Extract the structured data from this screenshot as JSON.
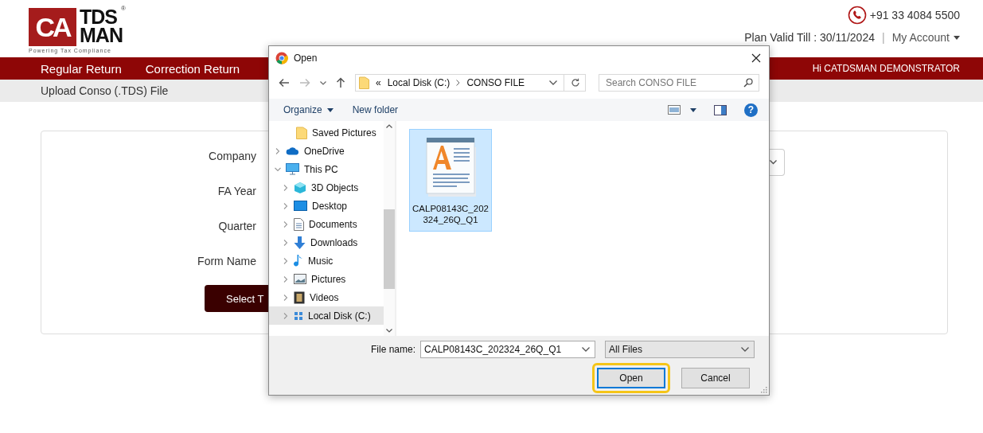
{
  "header": {
    "logo": {
      "mark": "CA",
      "line_1": "TDS",
      "line_2": "MAN",
      "tagline": "Powering Tax Compliance",
      "registered": "®"
    },
    "phone": "+91 33 4084 5500",
    "plan_valid": "Plan Valid Till : 30/11/2024",
    "separator": "|",
    "account_menu": "My Account"
  },
  "nav": {
    "items": [
      {
        "label": "Regular Return"
      },
      {
        "label": "Correction Return"
      }
    ],
    "greeting": "Hi CATDSMAN DEMONSTRATOR"
  },
  "breadcrumb": "Upload Conso (.TDS) File",
  "form": {
    "fields": [
      {
        "label": "Company"
      },
      {
        "label": "FA Year"
      },
      {
        "label": "Quarter"
      },
      {
        "label": "Form Name"
      }
    ],
    "button": "Select T"
  },
  "dialog": {
    "title": "Open",
    "path": {
      "overflow": "«",
      "segments": [
        "Local Disk (C:)",
        "CONSO FILE"
      ]
    },
    "search": {
      "placeholder": "Search CONSO FILE"
    },
    "toolbar": {
      "organize": "Organize",
      "new_folder": "New folder",
      "help": "?"
    },
    "tree": [
      {
        "label": "Saved Pictures",
        "kind": "folder"
      },
      {
        "label": "OneDrive",
        "kind": "cloud",
        "expanded": false
      },
      {
        "label": "This PC",
        "kind": "computer",
        "expanded": true,
        "children": [
          {
            "label": "3D Objects",
            "kind": "cube",
            "expanded": false,
            "selected": false
          },
          {
            "label": "Desktop",
            "kind": "desktop",
            "expanded": false,
            "selected": false
          },
          {
            "label": "Documents",
            "kind": "document",
            "expanded": false,
            "selected": false
          },
          {
            "label": "Downloads",
            "kind": "download",
            "expanded": false,
            "selected": false
          },
          {
            "label": "Music",
            "kind": "music",
            "expanded": false,
            "selected": false
          },
          {
            "label": "Pictures",
            "kind": "pictures",
            "expanded": false,
            "selected": false
          },
          {
            "label": "Videos",
            "kind": "video",
            "expanded": false,
            "selected": false
          },
          {
            "label": "Local Disk (C:)",
            "kind": "drive",
            "expanded": false,
            "selected": true
          }
        ]
      }
    ],
    "files": [
      {
        "name": "CALP08143C_202324_26Q_Q1",
        "selected": true
      }
    ],
    "file_name_label": "File name:",
    "file_name": "CALP08143C_202324_26Q_Q1",
    "file_type": "All Files",
    "buttons": [
      {
        "label": "Open",
        "highlighted": true
      },
      {
        "label": "Cancel",
        "highlighted": false
      }
    ]
  }
}
